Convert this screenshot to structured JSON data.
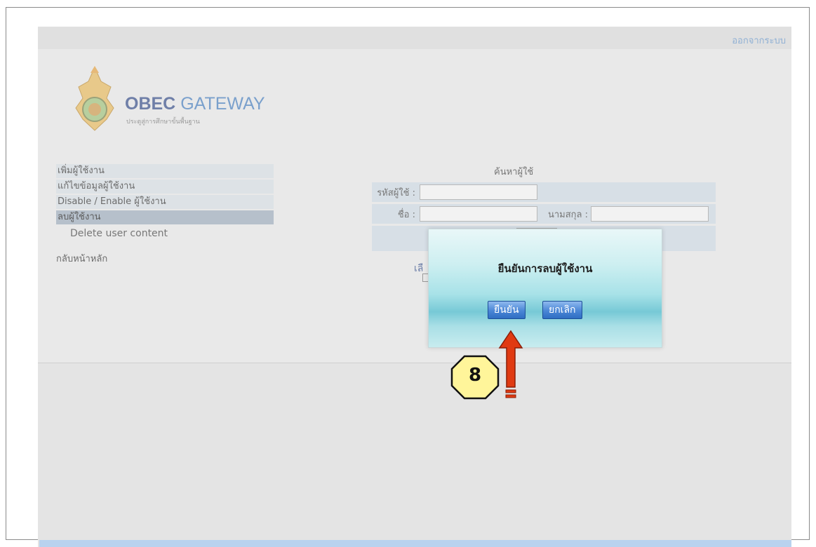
{
  "header": {
    "logout_label": "ออกจากระบบ"
  },
  "logo": {
    "title_part1": "OBEC",
    "title_part2": "GATEWAY",
    "subtitle": "ประตูสู่การศึกษาขั้นพื้นฐาน"
  },
  "sidebar": {
    "items": [
      {
        "label": "เพิ่มผู้ใช้งาน"
      },
      {
        "label": "แก้ไขข้อมูลผู้ใช้งาน"
      },
      {
        "label": "Disable / Enable ผู้ใช้งาน"
      },
      {
        "label": "ลบผู้ใช้งาน"
      }
    ],
    "sub_item": "Delete user content",
    "home_label": "กลับหน้าหลัก"
  },
  "search": {
    "title": "ค้นหาผู้ใช้",
    "userid_label": "รหัสผู้ใช้ :",
    "firstname_label": "ชื่อ :",
    "lastname_label": "นามสกุล :"
  },
  "results": {
    "fragment": "เลื"
  },
  "dialog": {
    "title": "ยืนยันการลบผู้ใช้งาน",
    "confirm_label": "ยืนยัน",
    "cancel_label": "ยกเลิก"
  },
  "annotation": {
    "step_number": "8"
  },
  "colors": {
    "badge_fill": "#fff59a",
    "arrow_red": "#e03a12",
    "link_blue": "#8fb0d4"
  }
}
